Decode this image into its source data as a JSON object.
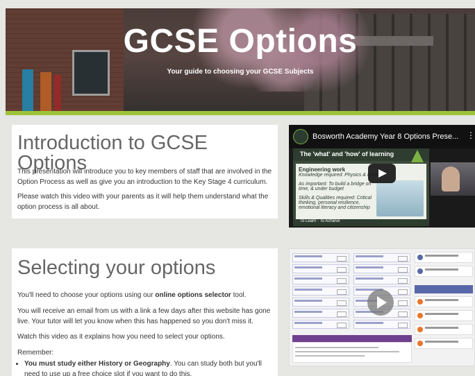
{
  "hero": {
    "title": "GCSE Options",
    "subtitle": "Your guide to choosing your GCSE Subjects"
  },
  "intro": {
    "heading": "Introduction to GCSE Options",
    "para1": "This presentation will introduce you to key members of staff that are involved in the Option Process as well as give you an introduction to the Key Stage 4 curriculum.",
    "para2": "Please watch this video with your parents as it will help them understand what the option process is all about."
  },
  "video1": {
    "title": "Bosworth Academy Year 8 Options Prese...",
    "slide_banner": "The 'what' and 'how' of learning",
    "slide_heading": "Engineering work",
    "slide_knowledge": "Knowledge required: Physics & Maths",
    "slide_important": "As important: To build a bridge on time, & under budget",
    "slide_skills": "Skills & Qualities required: Critical thinking, personal resilience, emotional literacy and citizenship",
    "slide_footer": "To Learn · To Achieve"
  },
  "selecting": {
    "heading": "Selecting your options",
    "p1_pre": "You'll need to choose your options using our ",
    "p1_bold": "online options selector",
    "p1_post": " tool.",
    "p2": "You will receive an email from us with a link a few days after this website has gone live.  Your tutor will let you know when this has happened so you don't miss it.",
    "p3": "Watch this video as it explains how you need to select your options.",
    "p4": "Remember:",
    "bullet1_bold": "You must study either History or Geography",
    "bullet1_rest": ".  You can study both but you'll need to use up a free choice slot if you want to do this."
  },
  "colors": {
    "accent": "#9dc33b",
    "heading_text": "#666666"
  }
}
